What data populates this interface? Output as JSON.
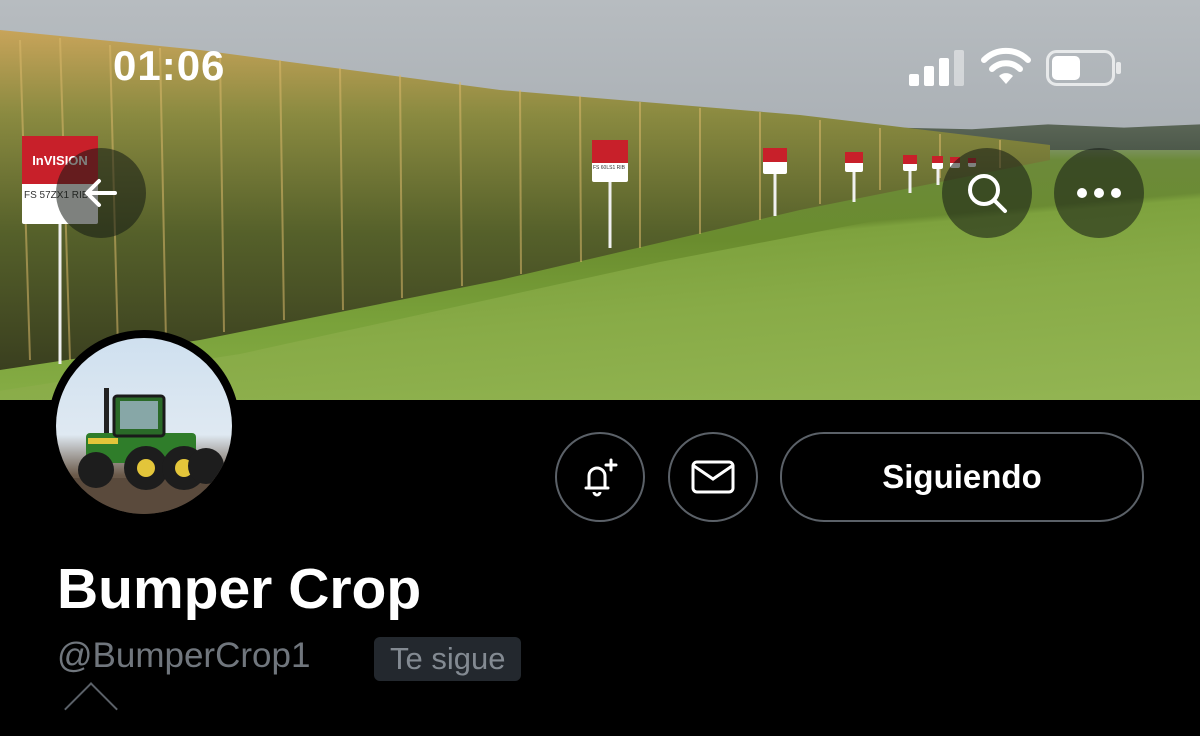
{
  "status_bar": {
    "time": "01:06"
  },
  "nav": {
    "back_icon": "arrow-left-icon",
    "search_icon": "search-icon",
    "more_icon": "more-horizontal-icon"
  },
  "banner": {
    "sign_brand": "InVISION",
    "sign_code_1": "FS 57ZX1 RIB",
    "sign_code_2": "FS 60LS1 RIB"
  },
  "profile": {
    "display_name": "Bumper Crop",
    "handle": "@BumperCrop1",
    "follows_you_badge": "Te sigue",
    "following_button": "Siguiendo",
    "notify_icon": "bell-plus-icon",
    "message_icon": "envelope-icon"
  },
  "colors": {
    "background": "#000000",
    "text_primary": "#ffffff",
    "text_secondary": "#70767d",
    "button_border": "#5b6168",
    "badge_bg": "#23282e"
  }
}
